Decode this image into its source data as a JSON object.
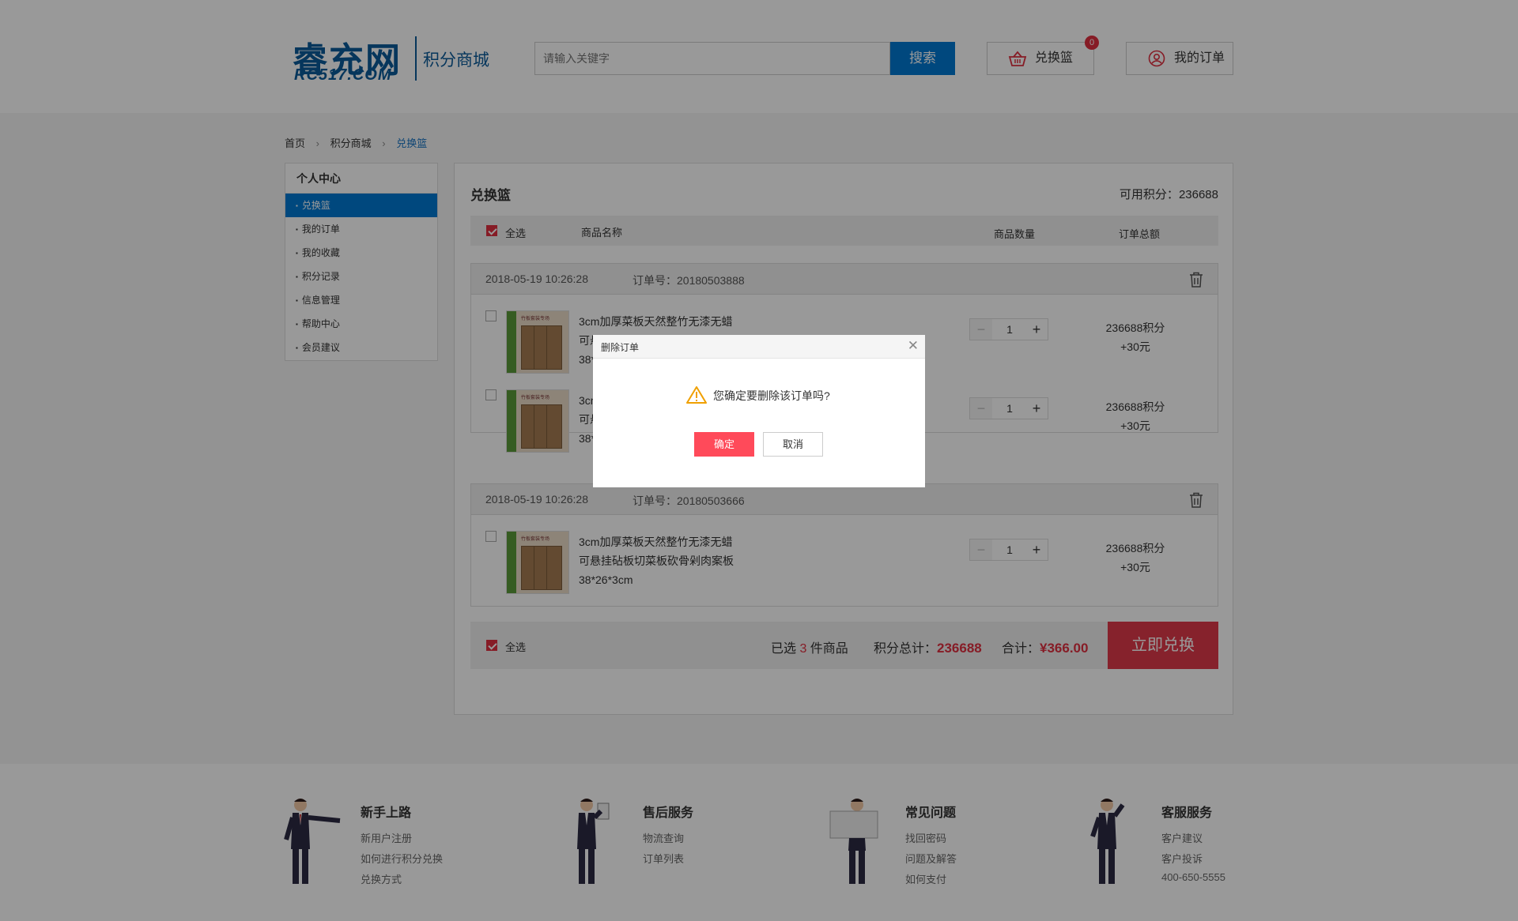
{
  "header": {
    "logo_cn": "睿充网",
    "logo_en": "RC517.COM",
    "logo_sub": "积分商城",
    "search_placeholder": "请输入关键字",
    "search_label": "搜索",
    "cart_label": "兑换篮",
    "cart_count": "0",
    "orders_label": "我的订单"
  },
  "breadcrumb": [
    "首页",
    "积分商城",
    "兑换篮"
  ],
  "sidebar": {
    "title": "个人中心",
    "items": [
      {
        "label": "兑换篮",
        "active": true
      },
      {
        "label": "我的订单"
      },
      {
        "label": "我的收藏"
      },
      {
        "label": "积分记录"
      },
      {
        "label": "信息管理"
      },
      {
        "label": "帮助中心"
      },
      {
        "label": "会员建议"
      }
    ]
  },
  "main": {
    "title": "兑换篮",
    "available_label": "可用积分：",
    "available_value": "236688",
    "columns": {
      "select_all": "全选",
      "name": "商品名称",
      "quantity": "商品数量",
      "total": "订单总额"
    }
  },
  "orders": [
    {
      "datetime": "2018-05-19  10:26:28",
      "order_no_label": "订单号：",
      "order_no": "20180503888",
      "items": [
        {
          "name_l1": "3cm加厚菜板天然整竹无漆无蜡",
          "name_l2": "可悬",
          "name_l3": "38*",
          "qty": "1",
          "price_l1": "236688积分",
          "price_l2": "+30元"
        },
        {
          "name_l1": "3cn",
          "name_l2": "可悬",
          "name_l3": "38*",
          "qty": "1",
          "price_l1": "236688积分",
          "price_l2": "+30元"
        }
      ]
    },
    {
      "datetime": "2018-05-19  10:26:28",
      "order_no_label": "订单号：",
      "order_no": "20180503666",
      "items": [
        {
          "name_l1": "3cm加厚菜板天然整竹无漆无蜡",
          "name_l2": "可悬挂砧板切菜板砍骨剁肉案板",
          "name_l3": "38*26*3cm",
          "qty": "1",
          "price_l1": "236688积分",
          "price_l2": "+30元"
        }
      ]
    }
  ],
  "thumb_caption": "竹板套装专场",
  "summary": {
    "select_all": "全选",
    "selected_prefix": "已选 ",
    "selected_count": "3",
    "selected_suffix": " 件商品",
    "points_label": "积分总计：",
    "points_value": "236688",
    "total_label": "合计：",
    "total_value": "¥366.00",
    "exchange_button": "立即兑换"
  },
  "footer": [
    {
      "title": "新手上路",
      "links": [
        "新用户注册",
        "如何进行积分兑换",
        "兑换方式"
      ]
    },
    {
      "title": "售后服务",
      "links": [
        "物流查询",
        "订单列表"
      ]
    },
    {
      "title": "常见问题",
      "links": [
        "找回密码",
        "问题及解答",
        "如何支付"
      ]
    },
    {
      "title": "客服服务",
      "links": [
        "客户建议",
        "客户投诉",
        "400-650-5555"
      ]
    }
  ],
  "dialog": {
    "title": "删除订单",
    "message": "您确定要删除该订单吗?",
    "confirm": "确定",
    "cancel": "取消"
  },
  "colors": {
    "brand_blue": "#0079d3",
    "accent_red": "#e03040",
    "overlay": "rgba(0,0,0,0.4)"
  }
}
